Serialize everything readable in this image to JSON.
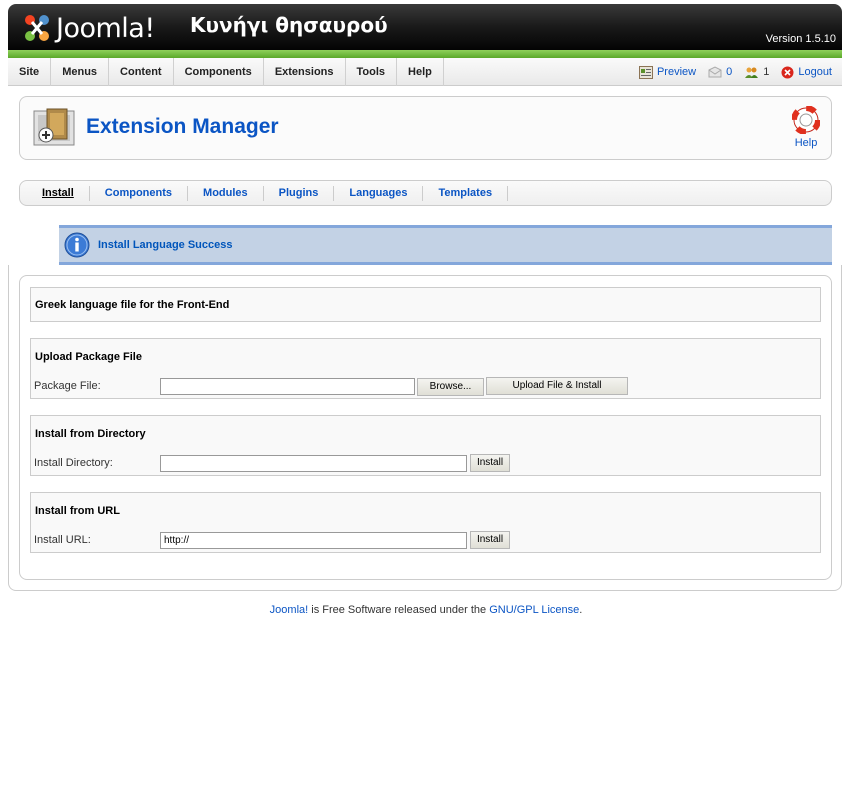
{
  "header": {
    "brand": "Joomla!",
    "site_name": "Κυνήγι θησαυρού",
    "version": "Version 1.5.10"
  },
  "menu": [
    "Site",
    "Menus",
    "Content",
    "Components",
    "Extensions",
    "Tools",
    "Help"
  ],
  "status": {
    "preview": "Preview",
    "messages_count": "0",
    "users_count": "1",
    "logout": "Logout"
  },
  "toolbar": {
    "title": "Extension Manager",
    "help": "Help"
  },
  "submenu": {
    "active": "Install",
    "items": [
      "Install",
      "Components",
      "Modules",
      "Plugins",
      "Languages",
      "Templates"
    ]
  },
  "message": "Install Language Success",
  "panels": {
    "result": "Greek language file for the Front-End",
    "upload": {
      "title": "Upload Package File",
      "label": "Package File:",
      "browse": "Browse...",
      "button": "Upload File & Install"
    },
    "directory": {
      "title": "Install from Directory",
      "label": "Install Directory:",
      "value": "",
      "button": "Install"
    },
    "url": {
      "title": "Install from URL",
      "label": "Install URL:",
      "value": "http://",
      "button": "Install"
    }
  },
  "footer": {
    "link1": "Joomla!",
    "middle": " is Free Software released under the ",
    "link2": "GNU/GPL License",
    "end": "."
  },
  "colors": {
    "link": "#0b55c4",
    "green_bar": "#6ab838",
    "message_bg": "#c3d2e5"
  }
}
